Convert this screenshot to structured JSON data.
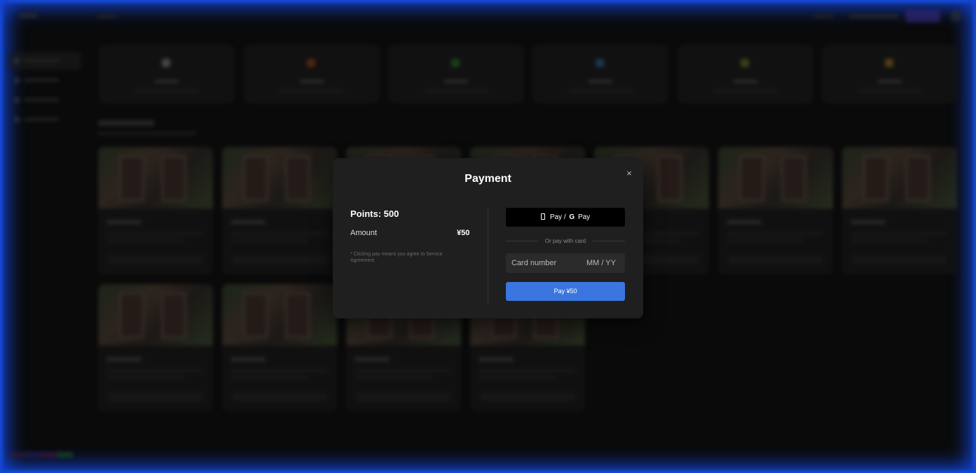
{
  "modal": {
    "title": "Payment",
    "close_icon": "×",
    "points_label": "Points: 500",
    "amount_label": "Amount",
    "amount_value": "¥50",
    "notice": "* Clicking pay means you agree to Service Agreement",
    "wallet_button": {
      "apple_part": "Pay /",
      "google_g": "G",
      "google_part": "Pay"
    },
    "separator_text": "Or pay with card",
    "card_number_placeholder": "Card number",
    "expiry_placeholder": "MM / YY",
    "pay_button_label": "Pay ¥50"
  },
  "colors": {
    "modal_bg": "#1f1f1f",
    "pay_button": "#3b76e0",
    "frame_glow": "#1244d6"
  },
  "icons": [
    "close-icon",
    "phone-icon",
    "google-g-icon"
  ]
}
